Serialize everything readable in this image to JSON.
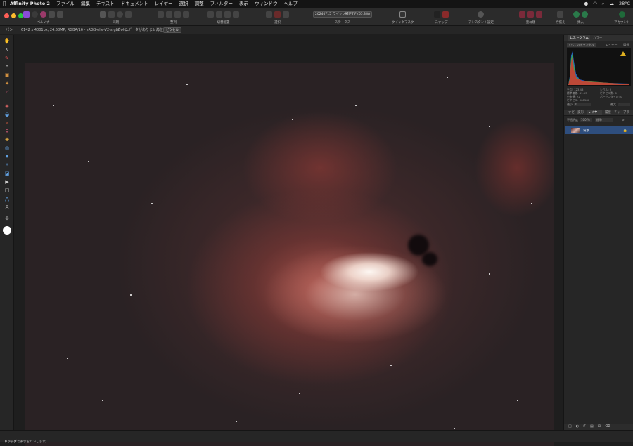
{
  "menubar": {
    "items": [
      "Affinity Photo 2",
      "ファイル",
      "編集",
      "テキスト",
      "ドキュメント",
      "レイヤー",
      "選択",
      "調整",
      "フィルター",
      "表示",
      "ウィンドウ",
      "ヘルプ"
    ],
    "temperature": "28°C"
  },
  "toolbar": {
    "persona_label": "ペルソナ",
    "modes_label": "同期",
    "arrange_label": "整列",
    "transform_label": "切替配置",
    "select_label": "選択",
    "status_label": "ステータス",
    "status_value": "20240715_ワイヤン補正TIF (65.3%)",
    "quickmask_label": "クイックマスク",
    "snap_label": "スナップ",
    "assistant_label": "アシスタント設定",
    "filter_label": "重ね順",
    "ops_label": "行揃え",
    "insert_label": "挿入",
    "account_label": "アカウント"
  },
  "context": {
    "tool_label": "パン",
    "doc_info": "6142 x 4001px, 24.58MP, RGBA/16 - sRGB-elle-V2-srgbtrc.icc",
    "metadata": "カメラデータがありません",
    "unit_label": "単位:",
    "unit_value": "ピクセル"
  },
  "panel": {
    "tab_histogram": "ヒストグラム",
    "tab_color": "カラー",
    "channel_select": "すべてのチャンネル",
    "layer_option": "レイヤー",
    "warn_option": "選択",
    "stats_left": [
      "平均: 123.48",
      "標準偏差: 41.53",
      "中央値: 72",
      "ピクセル: 308580"
    ],
    "stats_right": [
      "レベル: 2",
      "ピクセル数: 0",
      "パーセンタイル: 0"
    ],
    "min_label": "最小",
    "min_value": "0",
    "max_label": "最大",
    "max_value": "1",
    "layer_tabs": [
      "ナビ",
      "変形",
      "レイヤー",
      "履歴",
      "チャ",
      "ブラ"
    ],
    "opacity_label": "不透明度",
    "opacity_value": "100 %",
    "blend_mode": "標準",
    "layer_name": "背景"
  },
  "status": {
    "text": "ドラッグで表示をパンします。",
    "bold": "ドラッグ"
  }
}
